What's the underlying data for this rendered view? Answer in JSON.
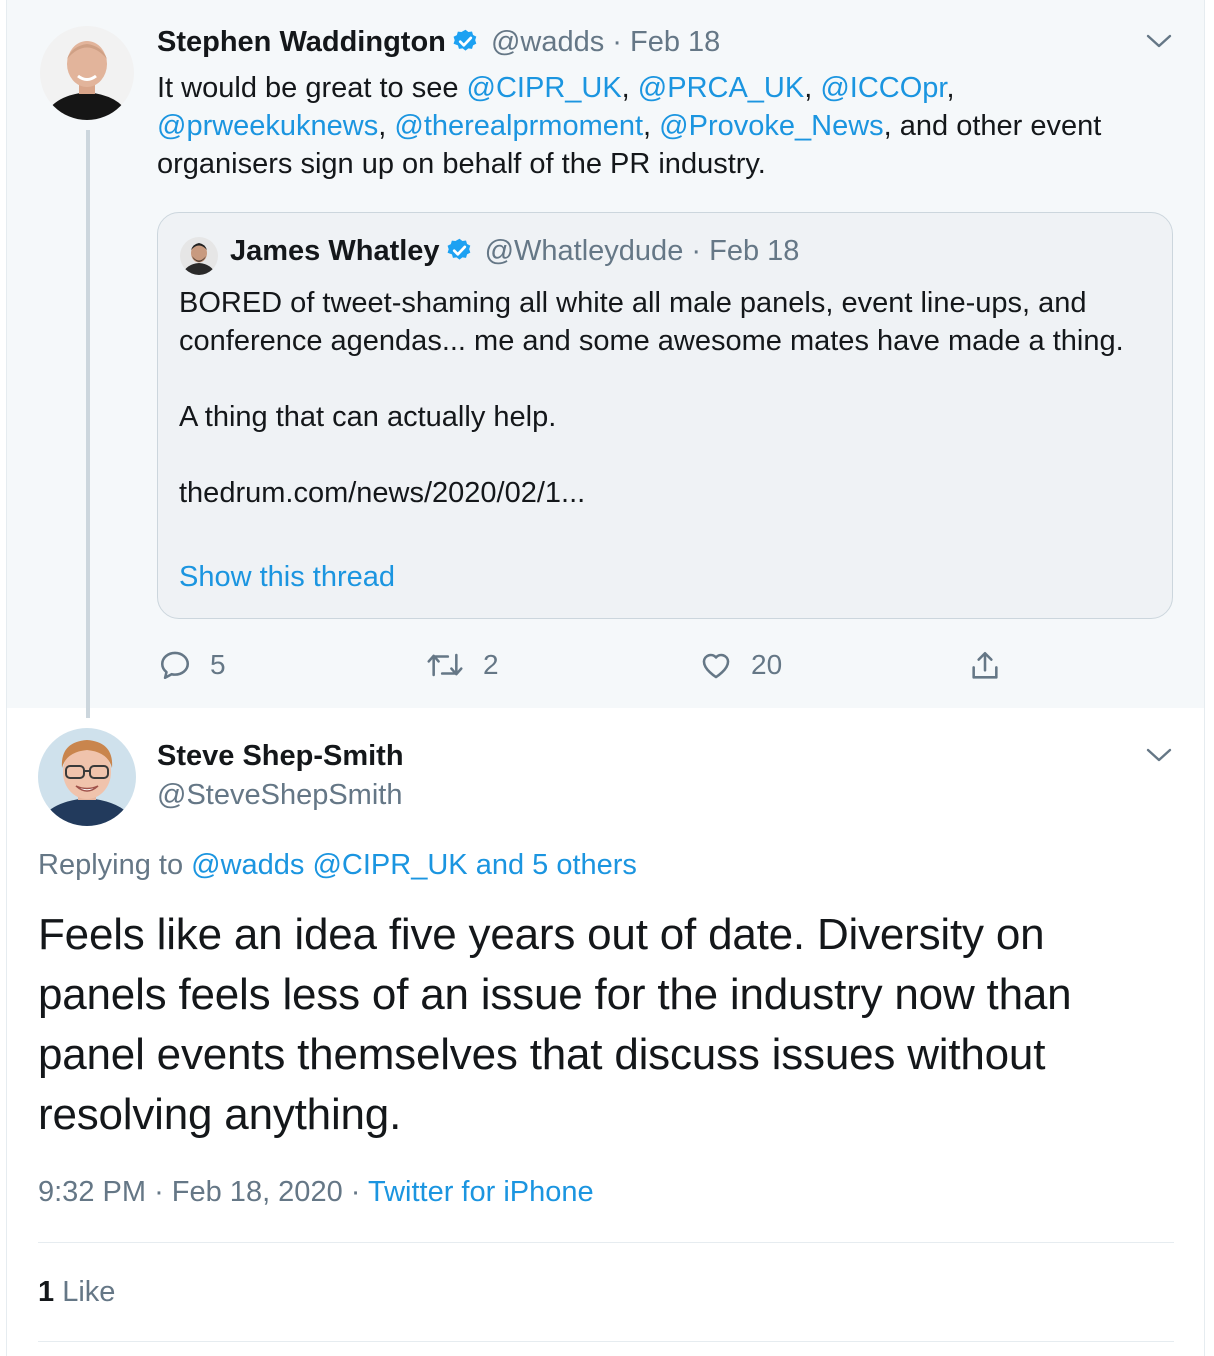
{
  "parent_tweet": {
    "author_name": "Stephen Waddington",
    "author_handle": "@wadds",
    "date": "Feb 18",
    "text_before": "It would be great to see ",
    "mentions": [
      "@CIPR_UK",
      "@PRCA_UK",
      "@ICCOpr",
      "@prweekuknews",
      "@therealprmoment",
      "@Provoke_News"
    ],
    "sep": ", ",
    "text_after": ", and other event organisers sign up on behalf of the PR industry.",
    "quoted": {
      "author_name": "James Whatley",
      "author_handle": "@Whatleydude",
      "date": "Feb 18",
      "para1": "BORED of tweet-shaming all white all male panels, event line-ups, and conference agendas... me and some awesome mates have made a thing.",
      "para2": "A thing that can actually help.",
      "para3": "thedrum.com/news/2020/02/1...",
      "show_thread": "Show this thread"
    },
    "actions": {
      "replies": "5",
      "retweets": "2",
      "likes": "20"
    }
  },
  "main_tweet": {
    "author_name": "Steve Shep-Smith",
    "author_handle": "@SteveShepSmith",
    "replying_label": "Replying to",
    "replying_mentions": "@wadds @CIPR_UK",
    "replying_others": "and 5 others",
    "text": "Feels like an idea five years out of date. Diversity on panels feels less of an issue for the industry now than panel events themselves that discuss issues without resolving anything.",
    "time": "9:32 PM",
    "date": "Feb 18, 2020",
    "source": "Twitter for iPhone",
    "likes_count": "1",
    "likes_label": "Like"
  },
  "colors": {
    "link": "#1b95e0",
    "verified": "#1da1f2",
    "muted": "#657786",
    "parent_bg": "#f5f8fa"
  },
  "icons": [
    "verified-badge-icon",
    "chevron-down-icon",
    "reply-icon",
    "retweet-icon",
    "heart-icon",
    "share-icon"
  ]
}
